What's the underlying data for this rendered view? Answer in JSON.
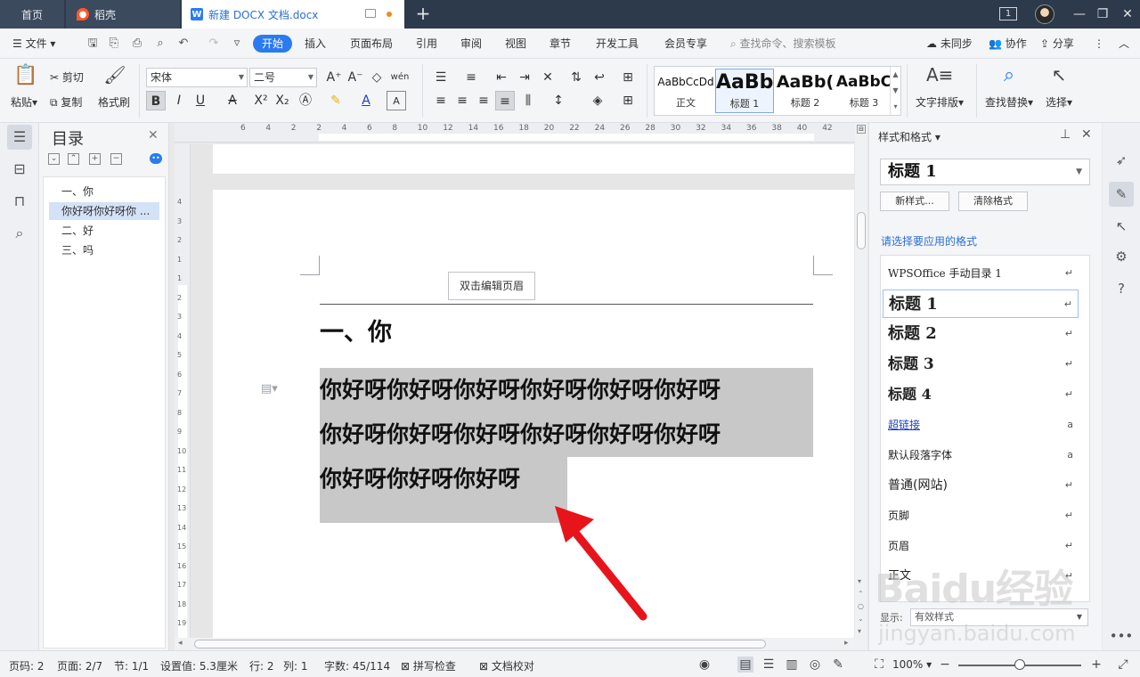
{
  "tabs": {
    "home": "首页",
    "daoke": "稻壳",
    "document": "新建 DOCX 文档.docx",
    "page_badge": "1"
  },
  "menu": {
    "file": "文件",
    "items": [
      "开始",
      "插入",
      "页面布局",
      "引用",
      "审阅",
      "视图",
      "章节",
      "开发工具",
      "会员专享"
    ],
    "search_placeholder": "查找命令、搜索模板",
    "sync": "未同步",
    "collab": "协作",
    "share": "分享"
  },
  "ribbon": {
    "paste": "粘贴",
    "cut": "剪切",
    "copy": "复制",
    "format_painter": "格式刷",
    "font_name": "宋体",
    "font_size": "二号",
    "styles": [
      {
        "preview": "AaBbCcDd",
        "name": "正文"
      },
      {
        "preview": "AaBb",
        "name": "标题 1"
      },
      {
        "preview": "AaBb(",
        "name": "标题 2"
      },
      {
        "preview": "AaBbC",
        "name": "标题 3"
      }
    ],
    "text_layout": "文字排版",
    "find_replace": "查找替换",
    "select": "选择"
  },
  "toc": {
    "title": "目录",
    "items": [
      "一、你",
      "你好呀你好呀你 ...",
      "二、好",
      "三、吗"
    ],
    "selected_index": 1
  },
  "ruler": {
    "h_numbers": [
      "6",
      "4",
      "2",
      "2",
      "4",
      "6",
      "8",
      "10",
      "12",
      "14",
      "16",
      "18",
      "20",
      "22",
      "24",
      "26",
      "28",
      "30",
      "32",
      "34",
      "36",
      "38",
      "40",
      "42"
    ],
    "v_numbers": [
      "4",
      "3",
      "2",
      "1",
      "1",
      "2",
      "3",
      "4",
      "5",
      "6",
      "7",
      "8",
      "9",
      "10",
      "11",
      "12",
      "13",
      "14",
      "15",
      "16",
      "17",
      "18",
      "19"
    ]
  },
  "document": {
    "header_hint": "双击编辑页眉",
    "heading": "一、你",
    "lines": [
      "你好呀你好呀你好呀你好呀你好呀你好呀",
      "你好呀你好呀你好呀你好呀你好呀你好呀",
      "你好呀你好呀你好呀"
    ]
  },
  "styles_pane": {
    "title": "样式和格式",
    "current": "标题  1",
    "new_style": "新样式...",
    "clear_format": "清除格式",
    "hint": "请选择要应用的格式",
    "items": [
      {
        "label": "WPSOffice 手动目录 1",
        "mark": "↵"
      },
      {
        "label": "标题  1",
        "mark": "↵"
      },
      {
        "label": "标题  2",
        "mark": "↵"
      },
      {
        "label": "标题  3",
        "mark": "↵"
      },
      {
        "label": "标题  4",
        "mark": "↵"
      },
      {
        "label": "超链接",
        "mark": "a"
      },
      {
        "label": "默认段落字体",
        "mark": "a"
      },
      {
        "label": "普通(网站)",
        "mark": "↵"
      },
      {
        "label": "页脚",
        "mark": "↵"
      },
      {
        "label": "页眉",
        "mark": "↵"
      },
      {
        "label": "正文",
        "mark": "↵"
      }
    ],
    "selected_index": 1,
    "show_label": "显示:",
    "show_value": "有效样式"
  },
  "status": {
    "page_no": "页码: 2",
    "page": "页面: 2/7",
    "section": "节: 1/1",
    "setting": "设置值: 5.3厘米",
    "row": "行: 2",
    "col": "列: 1",
    "words": "字数: 45/114",
    "spell": "拼写检查",
    "proof": "文档校对",
    "zoom": "100%"
  },
  "watermark": {
    "logo": "Baidu经验",
    "url": "jingyan.baidu.com"
  },
  "colors": {
    "accent": "#2b7bf0",
    "selection": "#c8c8c8",
    "arrow": "#e8141b"
  }
}
